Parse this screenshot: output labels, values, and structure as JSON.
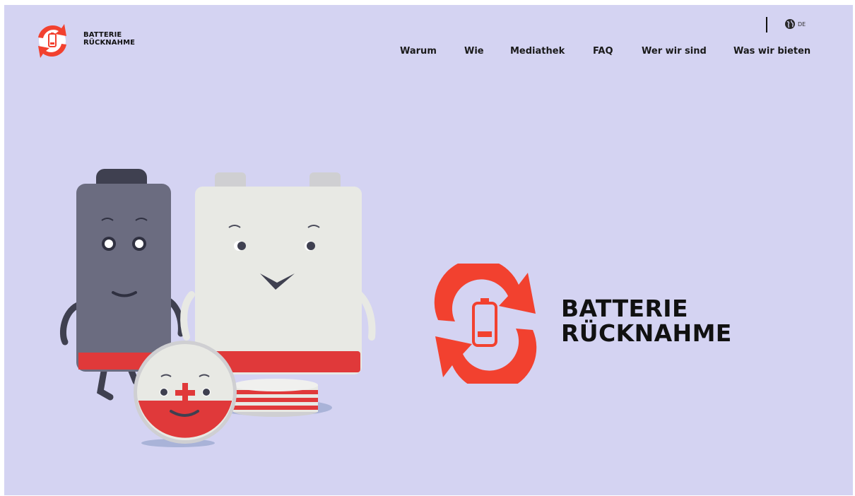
{
  "header": {
    "logo": {
      "line1": "BATTERIE",
      "line2": "RÜCKNAHME"
    },
    "language": {
      "code": "DE",
      "icon": "globe-icon"
    },
    "nav": [
      {
        "label": "Warum"
      },
      {
        "label": "Wie"
      },
      {
        "label": "Mediathek"
      },
      {
        "label": "FAQ"
      },
      {
        "label": "Wer wir sind"
      },
      {
        "label": "Was wir bieten"
      }
    ]
  },
  "hero": {
    "brand": {
      "line1": "BATTERIE",
      "line2": "RÜCKNAHME"
    },
    "illustration": "battery-characters"
  },
  "colors": {
    "background": "#d4d3f2",
    "brand_red": "#f2412f",
    "battery_dark": "#6b6c80",
    "battery_light": "#e8e9e4",
    "battery_red": "#e0393a",
    "text": "#111111"
  }
}
